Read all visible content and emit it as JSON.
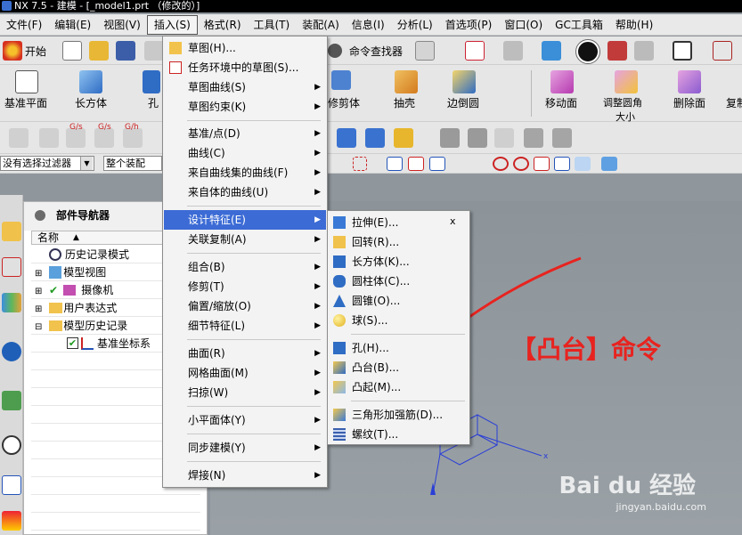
{
  "window": {
    "title": "NX 7.5 - 建模 - [_model1.prt （修改的）]"
  },
  "menubar": [
    {
      "label": "文件(F)"
    },
    {
      "label": "编辑(E)"
    },
    {
      "label": "视图(V)"
    },
    {
      "label": "插入(S)",
      "active": true
    },
    {
      "label": "格式(R)"
    },
    {
      "label": "工具(T)"
    },
    {
      "label": "装配(A)"
    },
    {
      "label": "信息(I)"
    },
    {
      "label": "分析(L)"
    },
    {
      "label": "首选项(P)"
    },
    {
      "label": "窗口(O)"
    },
    {
      "label": "GC工具箱"
    },
    {
      "label": "帮助(H)"
    }
  ],
  "toolbar1": {
    "start_label": "开始",
    "command_finder_label": "命令查找器"
  },
  "toolbar2": {
    "items": [
      "基准平面",
      "长方体",
      "孔",
      "修剪体",
      "抽壳",
      "边倒圆",
      "移动面",
      "调整圆角大小",
      "删除面",
      "复制"
    ],
    "resize_line2": "大小"
  },
  "toolbar3": {
    "labels": [
      "G/s",
      "G/s",
      "G/h"
    ]
  },
  "filter_bar": {
    "filter_value": "没有选择过滤器",
    "assembly_value": "整个装配"
  },
  "navigator": {
    "title": "部件导航器",
    "column": "名称",
    "rows": [
      "历史记录模式",
      "模型视图",
      "摄像机",
      "用户表达式",
      "模型历史记录",
      "基准坐标系"
    ]
  },
  "insert_menu": {
    "items": [
      "草图(H)...",
      "任务环境中的草图(S)...",
      "草图曲线(S)",
      "草图约束(K)",
      "基准/点(D)",
      "曲线(C)",
      "来自曲线集的曲线(F)",
      "来自体的曲线(U)",
      "设计特征(E)",
      "关联复制(A)",
      "组合(B)",
      "修剪(T)",
      "偏置/缩放(O)",
      "细节特征(L)",
      "曲面(R)",
      "网格曲面(M)",
      "扫掠(W)",
      "小平面体(Y)",
      "同步建模(Y)",
      "焊接(N)"
    ]
  },
  "design_feature_menu": {
    "close_mark": "x",
    "items": [
      "拉伸(E)...",
      "回转(R)...",
      "长方体(K)...",
      "圆柱体(C)...",
      "圆锥(O)...",
      "球(S)...",
      "孔(H)...",
      "凸台(B)...",
      "凸起(M)...",
      "三角形加强筋(D)...",
      "螺纹(T)..."
    ]
  },
  "annotation": {
    "text": "【凸台】命令",
    "color": "#e8231f"
  },
  "watermark": {
    "brand": "Bai du 经验",
    "url": "jingyan.baidu.com"
  },
  "colors": {
    "highlight": "#3c6bd5",
    "menu_bg": "#f3f3f3",
    "viewport": "#8f969c",
    "annotation": "#e8231f"
  }
}
